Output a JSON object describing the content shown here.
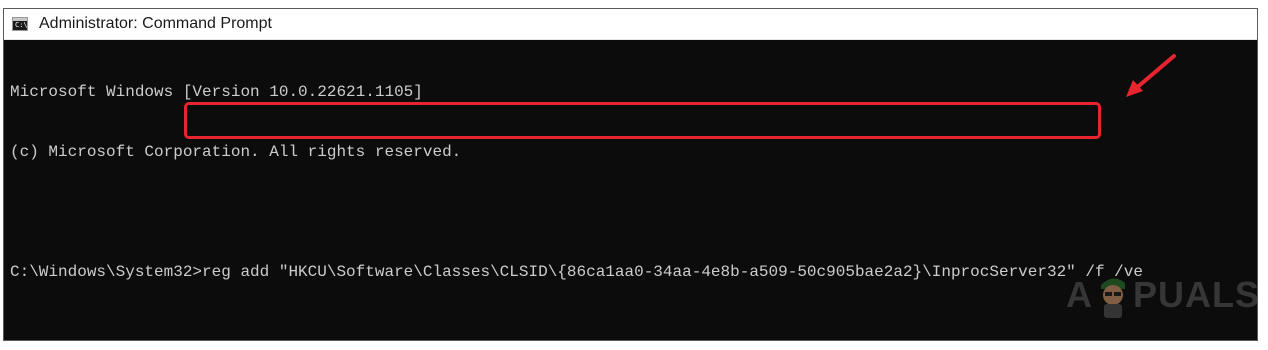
{
  "window": {
    "title": "Administrator: Command Prompt",
    "icon_text": "C:\\"
  },
  "console": {
    "lines": [
      "Microsoft Windows [Version 10.0.22621.1105]",
      "(c) Microsoft Corporation. All rights reserved.",
      "",
      "C:\\Windows\\System32>reg add \"HKCU\\Software\\Classes\\CLSID\\{86ca1aa0-34aa-4e8b-a509-50c905bae2a2}\\InprocServer32\" /f /ve"
    ]
  },
  "watermark": {
    "left_text": "A",
    "right_text": "PUALS"
  },
  "colors": {
    "console_bg": "#0c0c0c",
    "console_text": "#cccccc",
    "highlight": "#e8252f",
    "titlebar_bg": "#ffffff"
  }
}
